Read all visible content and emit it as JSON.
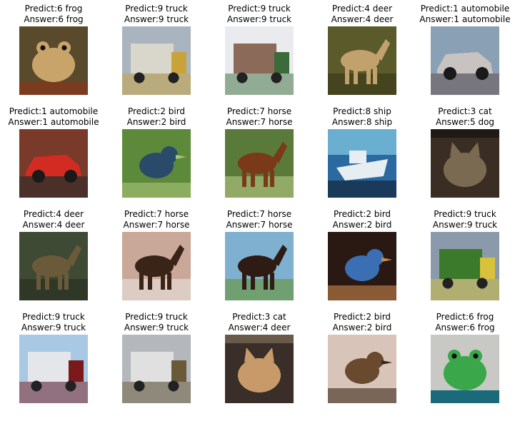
{
  "cells": [
    {
      "predict": "Predict:6 frog",
      "answer": "Answer:6 frog",
      "subject": "frog",
      "bg": "#5a4a2c",
      "fg": "#c9a46a",
      "accent": "#7a3b1e"
    },
    {
      "predict": "Predict:9 truck",
      "answer": "Answer:9 truck",
      "subject": "truck",
      "bg": "#a9b4bf",
      "fg": "#d9d6cc",
      "accent": "#c9a23a"
    },
    {
      "predict": "Predict:9 truck",
      "answer": "Answer:9 truck",
      "subject": "truck",
      "bg": "#e9ebee",
      "fg": "#8c6a5a",
      "accent": "#3b6b3a"
    },
    {
      "predict": "Predict:4 deer",
      "answer": "Answer:4 deer",
      "subject": "deer",
      "bg": "#5a5a2a",
      "fg": "#c2a26c",
      "accent": "#3a3a1a"
    },
    {
      "predict": "Predict:1 automobile",
      "answer": "Answer:1 automobile",
      "subject": "automobile",
      "bg": "#8aa0b4",
      "fg": "#c8c3c0",
      "accent": "#6a5a5a"
    },
    {
      "predict": "Predict:1 automobile",
      "answer": "Answer:1 automobile",
      "subject": "automobile",
      "bg": "#7a3a2a",
      "fg": "#d32a22",
      "accent": "#2a2a2a"
    },
    {
      "predict": "Predict:2 bird",
      "answer": "Answer:2 bird",
      "subject": "bird",
      "bg": "#5d8a3a",
      "fg": "#2a4a6a",
      "accent": "#a8c47a"
    },
    {
      "predict": "Predict:7 horse",
      "answer": "Answer:7 horse",
      "subject": "horse",
      "bg": "#5a7a3a",
      "fg": "#7a3a1a",
      "accent": "#a8c07a"
    },
    {
      "predict": "Predict:8 ship",
      "answer": "Answer:8 ship",
      "subject": "ship",
      "bg": "#2a6aa0",
      "fg": "#e6eef2",
      "accent": "#1a3a5a"
    },
    {
      "predict": "Predict:3 cat",
      "answer": "Answer:5 dog",
      "subject": "cat",
      "bg": "#3a2e24",
      "fg": "#7a6a52",
      "accent": "#1f1a14"
    },
    {
      "predict": "Predict:4 deer",
      "answer": "Answer:4 deer",
      "subject": "deer",
      "bg": "#3f4a34",
      "fg": "#6a5a3a",
      "accent": "#2a2f22"
    },
    {
      "predict": "Predict:7 horse",
      "answer": "Answer:7 horse",
      "subject": "horse",
      "bg": "#c9a89a",
      "fg": "#3a2418",
      "accent": "#e6dcd4"
    },
    {
      "predict": "Predict:7 horse",
      "answer": "Answer:7 horse",
      "subject": "horse",
      "bg": "#7fb0cf",
      "fg": "#2e1c14",
      "accent": "#6a9a4a"
    },
    {
      "predict": "Predict:2 bird",
      "answer": "Answer:2 bird",
      "subject": "bird",
      "bg": "#2a1812",
      "fg": "#3b6fb4",
      "accent": "#c9874a"
    },
    {
      "predict": "Predict:9 truck",
      "answer": "Answer:9 truck",
      "subject": "truck",
      "bg": "#8a9aaa",
      "fg": "#3a7a2a",
      "accent": "#d8c23a"
    },
    {
      "predict": "Predict:9 truck",
      "answer": "Answer:9 truck",
      "subject": "truck",
      "bg": "#a8c8e4",
      "fg": "#e4e6ea",
      "accent": "#7a1a1a"
    },
    {
      "predict": "Predict:9 truck",
      "answer": "Answer:9 truck",
      "subject": "truck",
      "bg": "#b4b8bc",
      "fg": "#e0e0e0",
      "accent": "#6a5a3a"
    },
    {
      "predict": "Predict:3 cat",
      "answer": "Answer:4 deer",
      "subject": "cat",
      "bg": "#3a2e28",
      "fg": "#c89a6a",
      "accent": "#6a5a4a"
    },
    {
      "predict": "Predict:2 bird",
      "answer": "Answer:2 bird",
      "subject": "bird",
      "bg": "#d8c4b8",
      "fg": "#6a4a2e",
      "accent": "#3a2818"
    },
    {
      "predict": "Predict:6 frog",
      "answer": "Answer:6 frog",
      "subject": "frog",
      "bg": "#c8c8c4",
      "fg": "#3aa84a",
      "accent": "#1a6a7a"
    }
  ]
}
